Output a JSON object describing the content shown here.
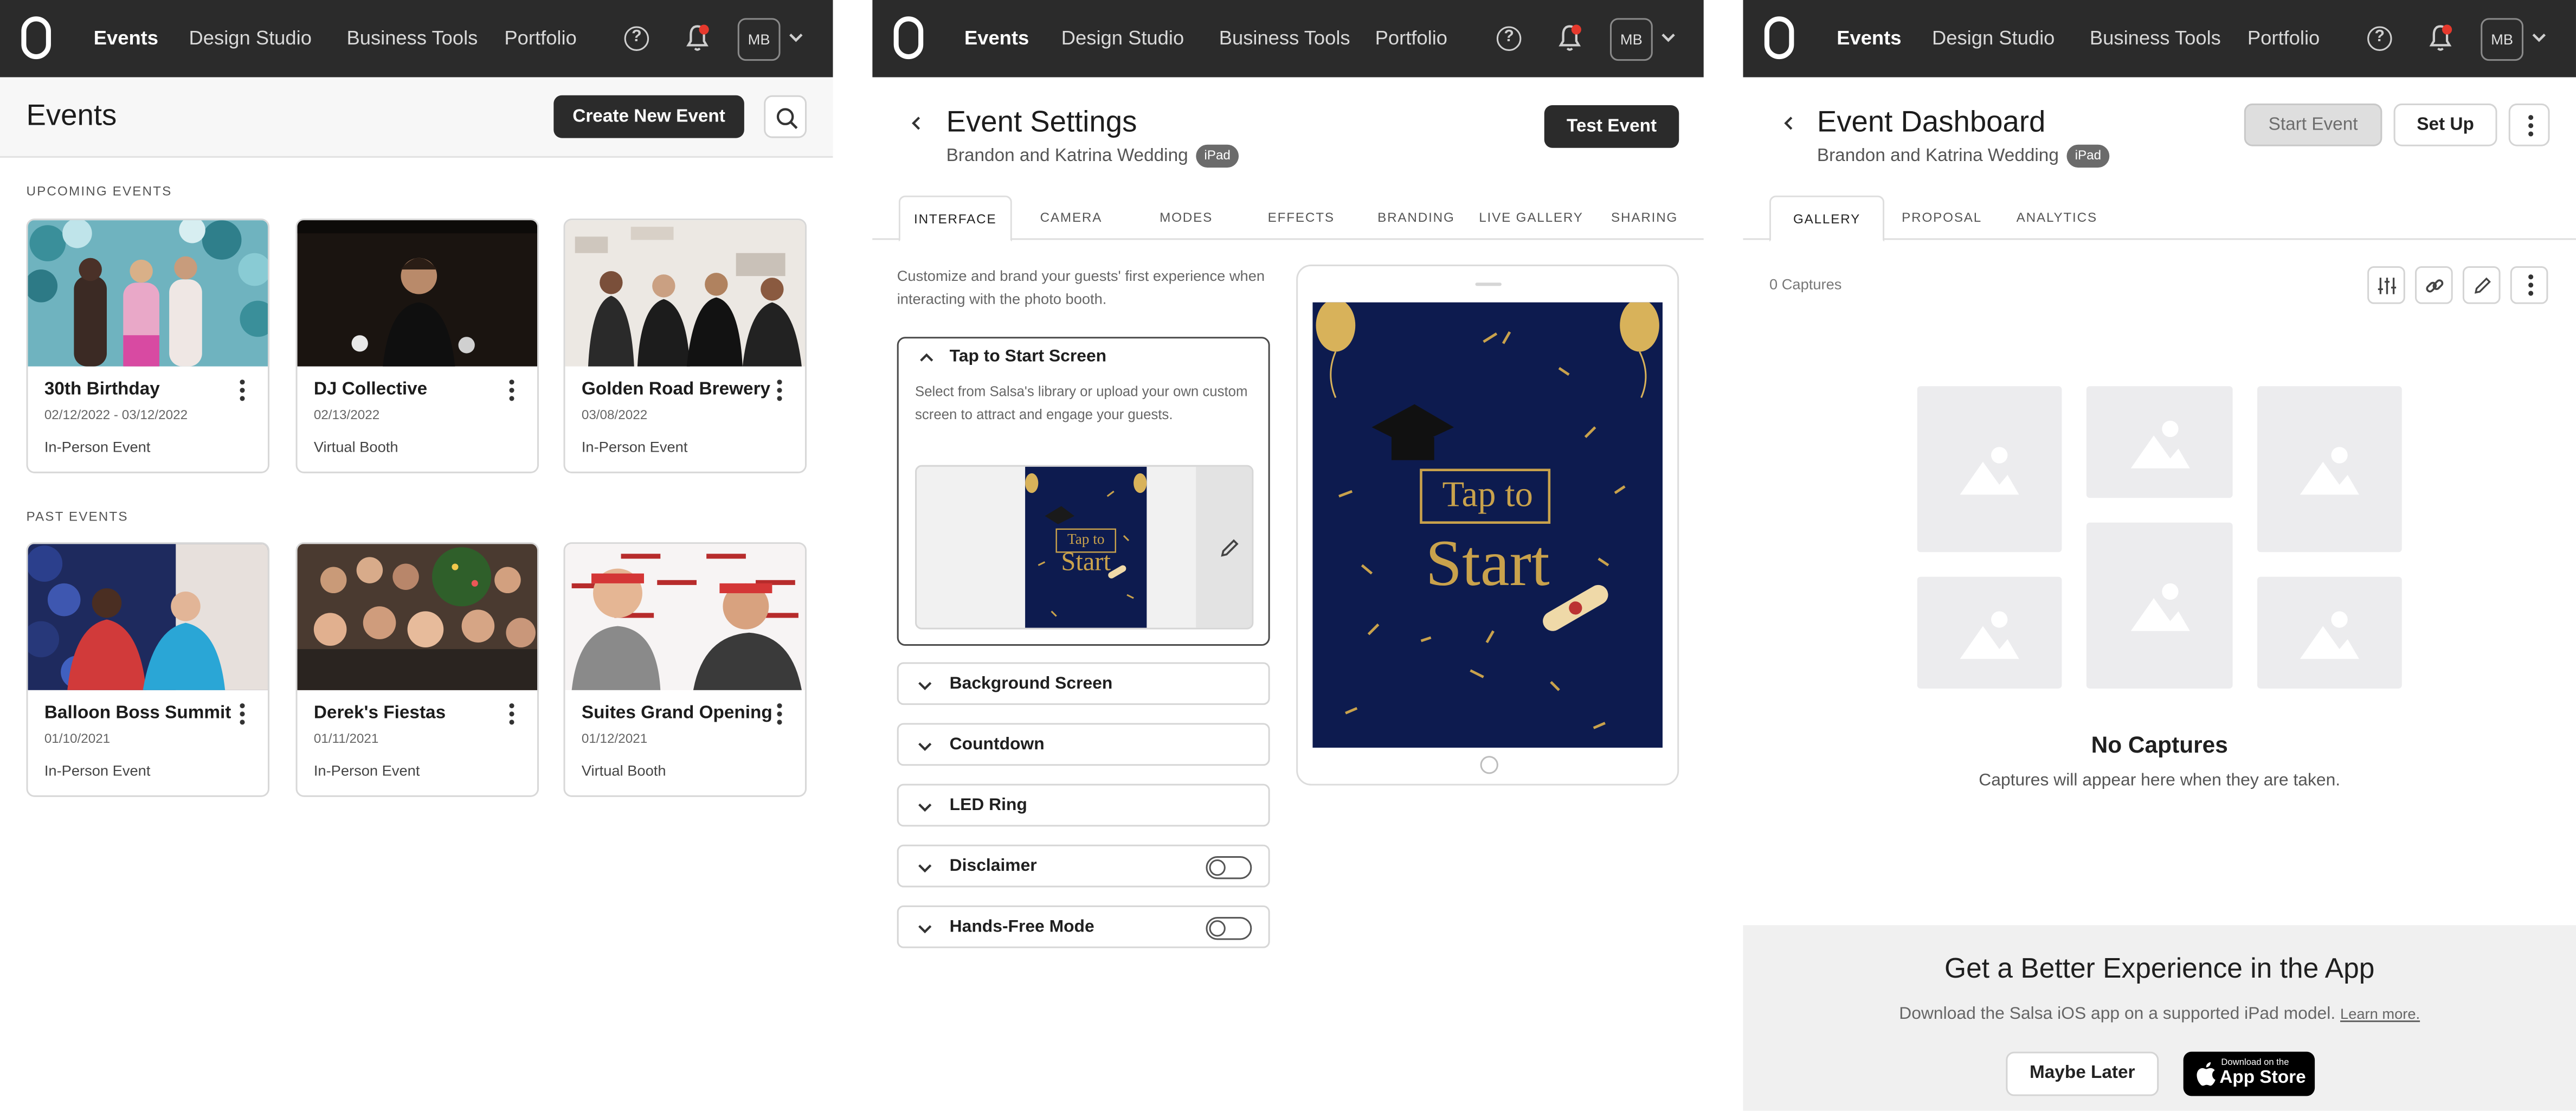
{
  "nav": {
    "items": [
      "Events",
      "Design Studio",
      "Business Tools",
      "Portfolio"
    ],
    "help_glyph": "?",
    "avatar": "MB"
  },
  "events_page": {
    "title": "Events",
    "create_label": "Create New Event",
    "upcoming_label": "UPCOMING EVENTS",
    "past_label": "PAST EVENTS",
    "upcoming": [
      {
        "title": "30th Birthday",
        "date": "02/12/2022 - 03/12/2022",
        "type": "In-Person Event"
      },
      {
        "title": "DJ Collective",
        "date": "02/13/2022",
        "type": "Virtual Booth"
      },
      {
        "title": "Golden Road Brewery",
        "date": "03/08/2022",
        "type": "In-Person Event"
      }
    ],
    "past": [
      {
        "title": "Balloon Boss Summit",
        "date": "01/10/2021",
        "type": "In-Person Event"
      },
      {
        "title": "Derek's Fiestas",
        "date": "01/11/2021",
        "type": "In-Person Event"
      },
      {
        "title": "Suites Grand Opening",
        "date": "01/12/2021",
        "type": "Virtual Booth"
      }
    ]
  },
  "settings_page": {
    "title": "Event Settings",
    "subtitle": "Brandon and Katrina Wedding",
    "badge": "iPad",
    "test_label": "Test Event",
    "tabs": [
      "INTERFACE",
      "CAMERA",
      "MODES",
      "EFFECTS",
      "BRANDING",
      "LIVE GALLERY",
      "SHARING"
    ],
    "description": "Customize and brand your guests' first experience when interacting with the photo booth.",
    "tap_section": {
      "label": "Tap to Start Screen",
      "description": "Select from Salsa's library or upload your own custom screen to attract and engage your guests.",
      "thumb_line1": "Tap to",
      "thumb_line2": "Start"
    },
    "sections": [
      "Background Screen",
      "Countdown",
      "LED Ring",
      "Disclaimer",
      "Hands-Free Mode"
    ],
    "preview": {
      "line1": "Tap to",
      "line2": "Start"
    }
  },
  "dashboard_page": {
    "title": "Event Dashboard",
    "subtitle": "Brandon and Katrina Wedding",
    "badge": "iPad",
    "start_label": "Start Event",
    "setup_label": "Set Up",
    "tabs": [
      "GALLERY",
      "PROPOSAL",
      "ANALYTICS"
    ],
    "captures_count": "0 Captures",
    "empty_title": "No Captures",
    "empty_text": "Captures will appear here when they are taken.",
    "promo_title": "Get a Better Experience in the App",
    "promo_text": "Download the Salsa iOS app on a supported iPad model.",
    "promo_link": "Learn more.",
    "maybe_later": "Maybe Later",
    "appstore_small": "Download on the",
    "appstore_big": "App Store"
  },
  "colors": {
    "nav_bg": "#2b2b2b",
    "navy": "#0d1b4f",
    "gold": "#c9a24c",
    "accent_red": "#e5392d"
  }
}
